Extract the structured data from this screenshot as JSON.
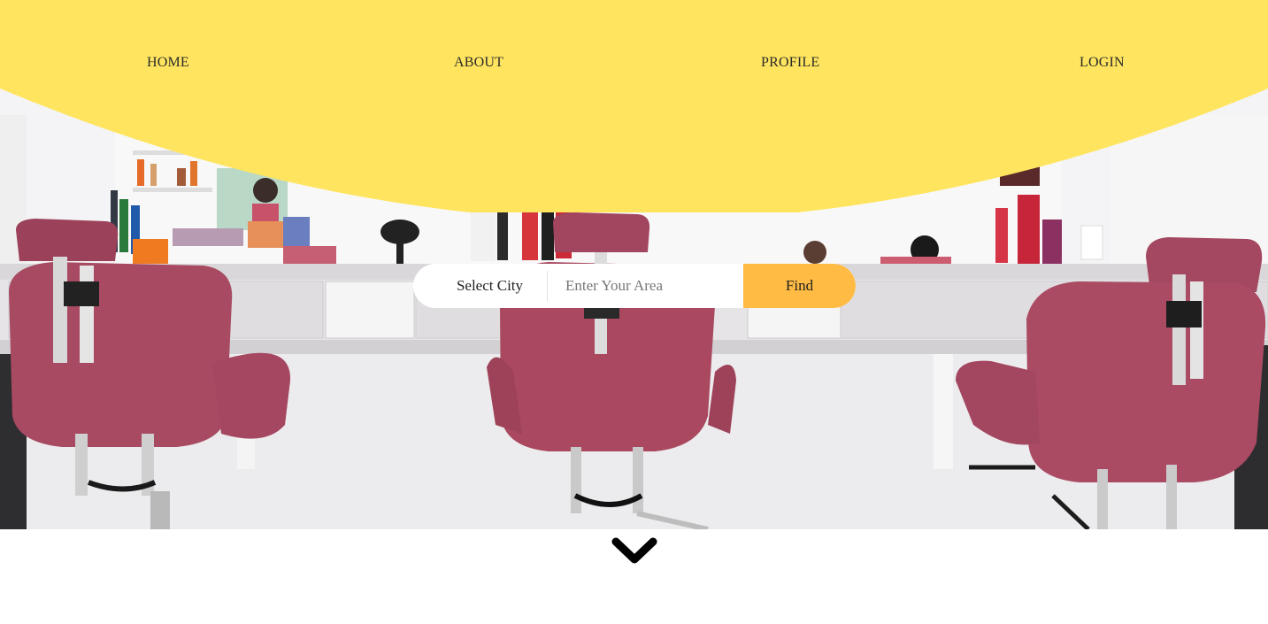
{
  "nav": {
    "home": "HOME",
    "about": "ABOUT",
    "profile": "PROFILE",
    "login": "LOGIN"
  },
  "search": {
    "city_label": "Select City",
    "area_placeholder": "Enter Your Area",
    "area_value": "",
    "find_label": "Find"
  },
  "icons": {
    "scroll_down": "chevron-down-icon"
  },
  "colors": {
    "nav_background": "#ffe55f",
    "find_button": "#ffbb44",
    "text": "#1f1f1f"
  }
}
